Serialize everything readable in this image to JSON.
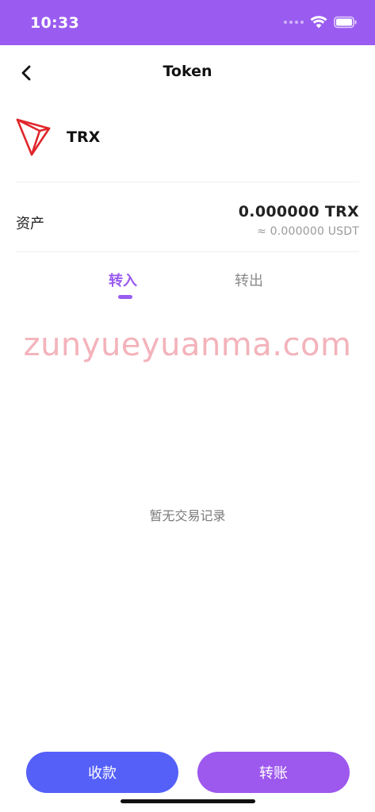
{
  "status_bar": {
    "time": "10:33",
    "icons": [
      "signal-dots",
      "wifi-icon",
      "battery-icon"
    ]
  },
  "nav": {
    "title": "Token",
    "back_icon": "chevron-left-icon"
  },
  "token": {
    "name": "TRX",
    "logo": "tron-logo"
  },
  "asset": {
    "label": "资产",
    "amount": "0.000000 TRX",
    "usdt": "≈ 0.000000 USDT"
  },
  "tabs": [
    {
      "label": "转入",
      "active": true
    },
    {
      "label": "转出",
      "active": false
    }
  ],
  "watermark": "zunyueyuanma.com",
  "empty_state": "暂无交易记录",
  "buttons": {
    "receive": "收款",
    "transfer": "转账"
  },
  "colors": {
    "accent": "#9a5cf0",
    "receive_button": "#5560f8",
    "transfer_button": "#9d58ee",
    "tron_red": "#e0262b"
  }
}
